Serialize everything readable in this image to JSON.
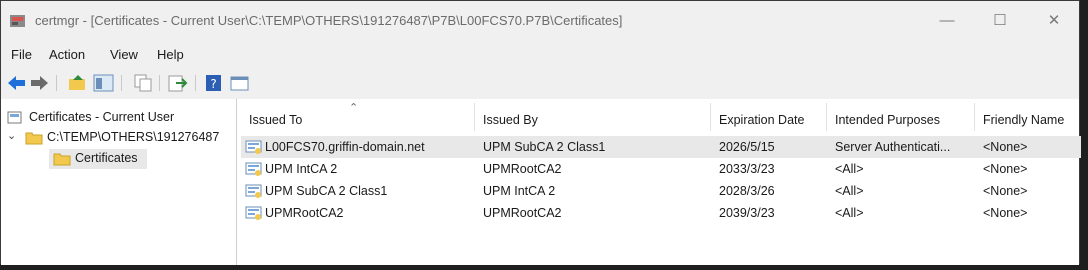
{
  "window": {
    "title": "certmgr - [Certificates - Current User\\C:\\TEMP\\OTHERS\\191276487\\P7B\\L00FCS70.P7B\\Certificates]"
  },
  "menu": {
    "items": [
      "File",
      "Action",
      "View",
      "Help"
    ]
  },
  "tree": {
    "root": "Certificates - Current User",
    "child": "C:\\TEMP\\OTHERS\\191276487",
    "leaf": "Certificates"
  },
  "list": {
    "columns": [
      "Issued To",
      "Issued By",
      "Expiration Date",
      "Intended Purposes",
      "Friendly Name"
    ],
    "rows": [
      [
        "L00FCS70.griffin-domain.net",
        "UPM SubCA 2 Class1",
        "2026/5/15",
        "Server Authenticati...",
        "<None>"
      ],
      [
        "UPM IntCA 2",
        "UPMRootCA2",
        "2033/3/23",
        "<All>",
        "<None>"
      ],
      [
        "UPM SubCA 2 Class1",
        "UPM IntCA 2",
        "2028/3/26",
        "<All>",
        "<None>"
      ],
      [
        "UPMRootCA2",
        "UPMRootCA2",
        "2039/3/23",
        "<All>",
        "<None>"
      ]
    ]
  },
  "colors": {
    "selection": "#e8e8e8",
    "accent": "#1e6fd9",
    "folder": "#f2c94c"
  }
}
